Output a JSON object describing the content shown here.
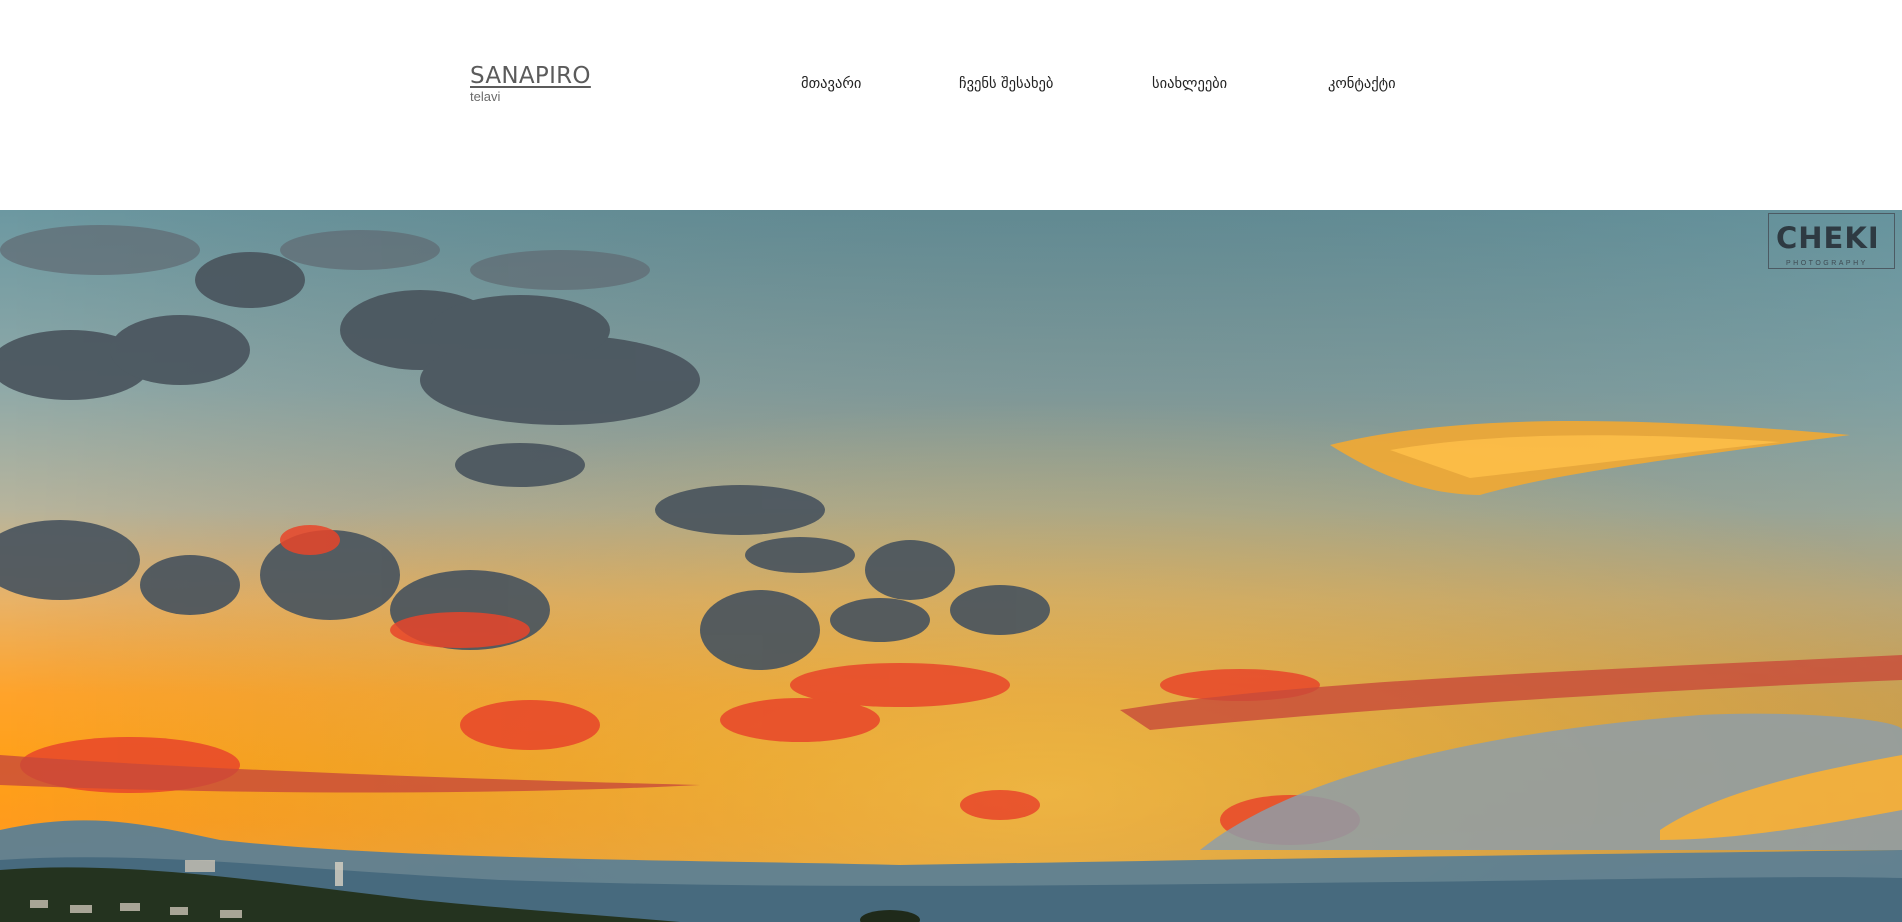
{
  "brand": {
    "title": "SANAPIRO",
    "subtitle": "telavi"
  },
  "nav": {
    "items": [
      {
        "label": "მთავარი"
      },
      {
        "label": "ჩვენს შესახებ"
      },
      {
        "label": "სიახლეები"
      },
      {
        "label": "კონტაქტი"
      }
    ]
  },
  "hero": {
    "image": "sunset-over-mountains",
    "watermark": {
      "text": "CHEKI",
      "subtext": "PHOTOGRAPHY"
    }
  },
  "colors": {
    "background": "#ffffff",
    "nav_text": "#222222",
    "brand_text": "#5b5b5b",
    "sky_top": "#6f9aa3",
    "sky_sunset": "#ff9a1e"
  }
}
